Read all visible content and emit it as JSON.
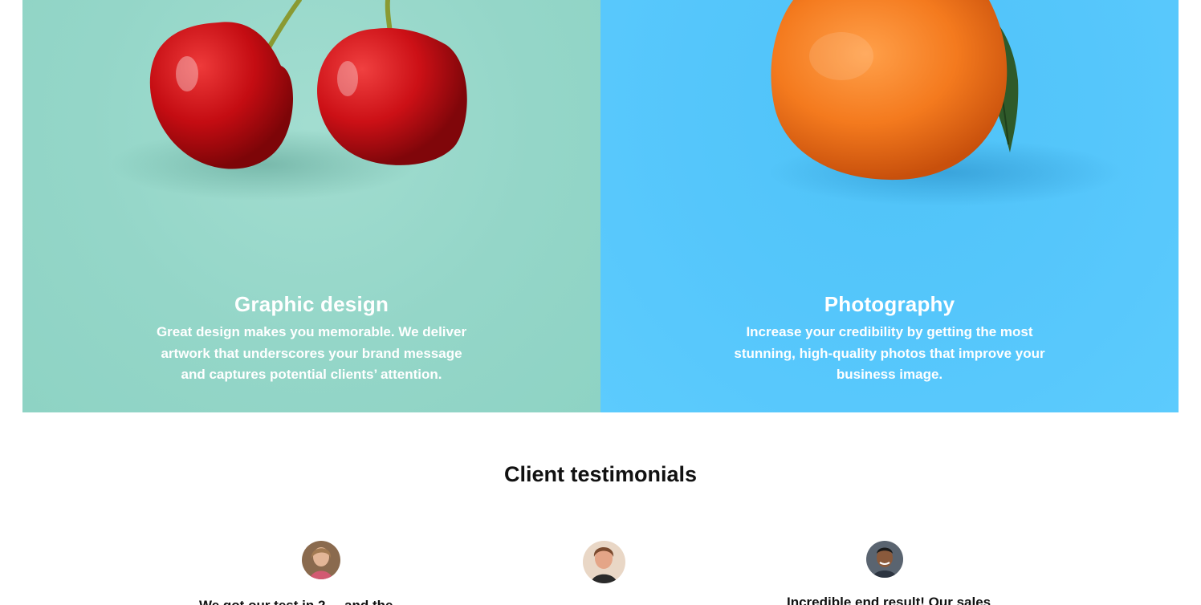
{
  "services": [
    {
      "title": "Graphic design",
      "description": "Great design makes you memorable. We deliver artwork that underscores your brand message and captures potential clients’ attention."
    },
    {
      "title": "Photography",
      "description": "Increase your credibility by getting the most stunning, high-quality photos that improve your business image."
    }
  ],
  "testimonials": {
    "title": "Client testimonials",
    "items": [
      {
        "quote": "We got our test in 2 ... and the"
      },
      {
        "quote": ""
      },
      {
        "quote": "Incredible end result! Our sales"
      }
    ]
  },
  "colors": {
    "cherries_background": "#94d6c8",
    "orange_background": "#55c6fb",
    "heading_text": "#111111"
  }
}
